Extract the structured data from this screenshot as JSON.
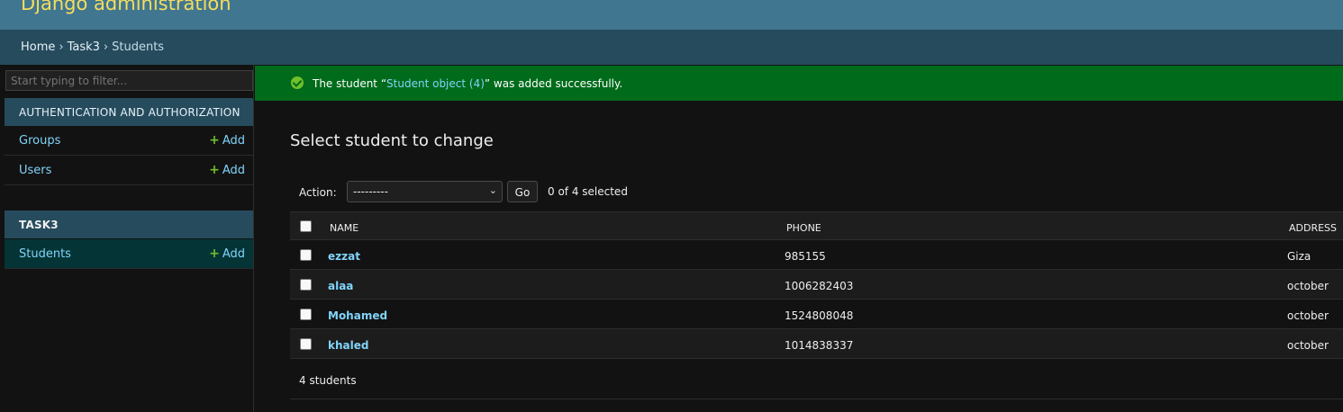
{
  "header": {
    "branding": "Django administration"
  },
  "breadcrumbs": {
    "home": "Home",
    "app": "Task3",
    "current": "Students",
    "separator": "›"
  },
  "sidebar": {
    "filter_placeholder": "Start typing to filter...",
    "auth_module": {
      "caption": "AUTHENTICATION AND AUTHORIZATION",
      "models": [
        {
          "name": "Groups",
          "add_label": "Add"
        },
        {
          "name": "Users",
          "add_label": "Add"
        }
      ]
    },
    "task3_module": {
      "caption": "TASK3",
      "models": [
        {
          "name": "Students",
          "add_label": "Add"
        }
      ]
    },
    "add_icon": "+"
  },
  "message": {
    "prefix": "The student “",
    "link": "Student object (4)",
    "suffix": "” was added successfully."
  },
  "content": {
    "title": "Select student to change",
    "actions": {
      "label": "Action:",
      "selected_option": "---------",
      "go_label": "Go",
      "counter": "0 of 4 selected"
    },
    "table": {
      "headers": {
        "name": "NAME",
        "phone": "PHONE",
        "address": "ADDRESS"
      },
      "rows": [
        {
          "name": "ezzat",
          "phone": "985155",
          "address": "Giza"
        },
        {
          "name": "alaa",
          "phone": "1006282403",
          "address": "october"
        },
        {
          "name": "Mohamed",
          "phone": "1524808048",
          "address": "october"
        },
        {
          "name": "khaled",
          "phone": "1014838337",
          "address": "october"
        }
      ]
    },
    "paginator": "4 students"
  },
  "colors": {
    "header_bg": "#417690",
    "branding": "#f5dd5d",
    "breadcrumbs_bg": "#264b5d",
    "success_bg": "#006b1b",
    "link": "#81d4fa",
    "add_plus": "#70bf2b"
  }
}
